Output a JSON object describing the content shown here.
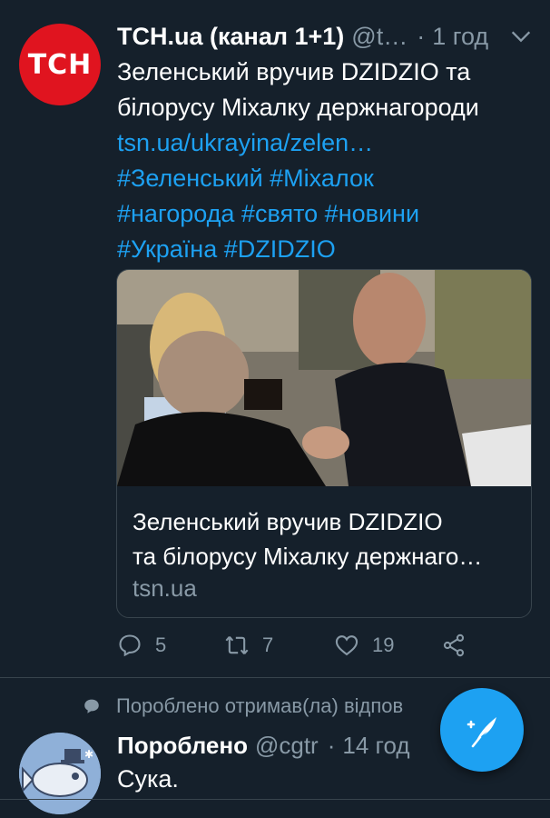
{
  "tweet": {
    "avatar_text": "ТСН",
    "display_name": "ТСН.ua (канал 1+1)",
    "handle": "@t…",
    "separator": "·",
    "time": "1 год",
    "text_line1": "Зеленський вручив DZIDZIO та",
    "text_line2": "білорусу Міхалку держнагороди",
    "link": "tsn.ua/ukrayina/zelen…",
    "hashtags_line1": "#Зеленський #Міхалок",
    "hashtags_line2": "#нагорода #свято #новини",
    "hashtags_line3": "#Україна #DZIDZIO",
    "card": {
      "title_line1": "Зеленський вручив DZIDZIO",
      "title_line2": "та білорусу Міхалку держнаго…",
      "domain": "tsn.ua"
    },
    "actions": {
      "replies": "5",
      "retweets": "7",
      "likes": "19"
    }
  },
  "reply": {
    "context": "Пороблено отримав(ла) відпов",
    "display_name": "Пороблено",
    "handle": "@cgtr",
    "separator": "·",
    "time": "14 год",
    "text": "Сука."
  },
  "colors": {
    "background": "#15202b",
    "accent": "#1da1f2",
    "secondary_text": "#8899a6",
    "tsn_red": "#e0141f"
  },
  "icons": [
    "chevron-down-icon",
    "reply-icon",
    "retweet-icon",
    "like-icon",
    "share-icon",
    "speech-bubble-icon",
    "compose-tweet-icon"
  ]
}
